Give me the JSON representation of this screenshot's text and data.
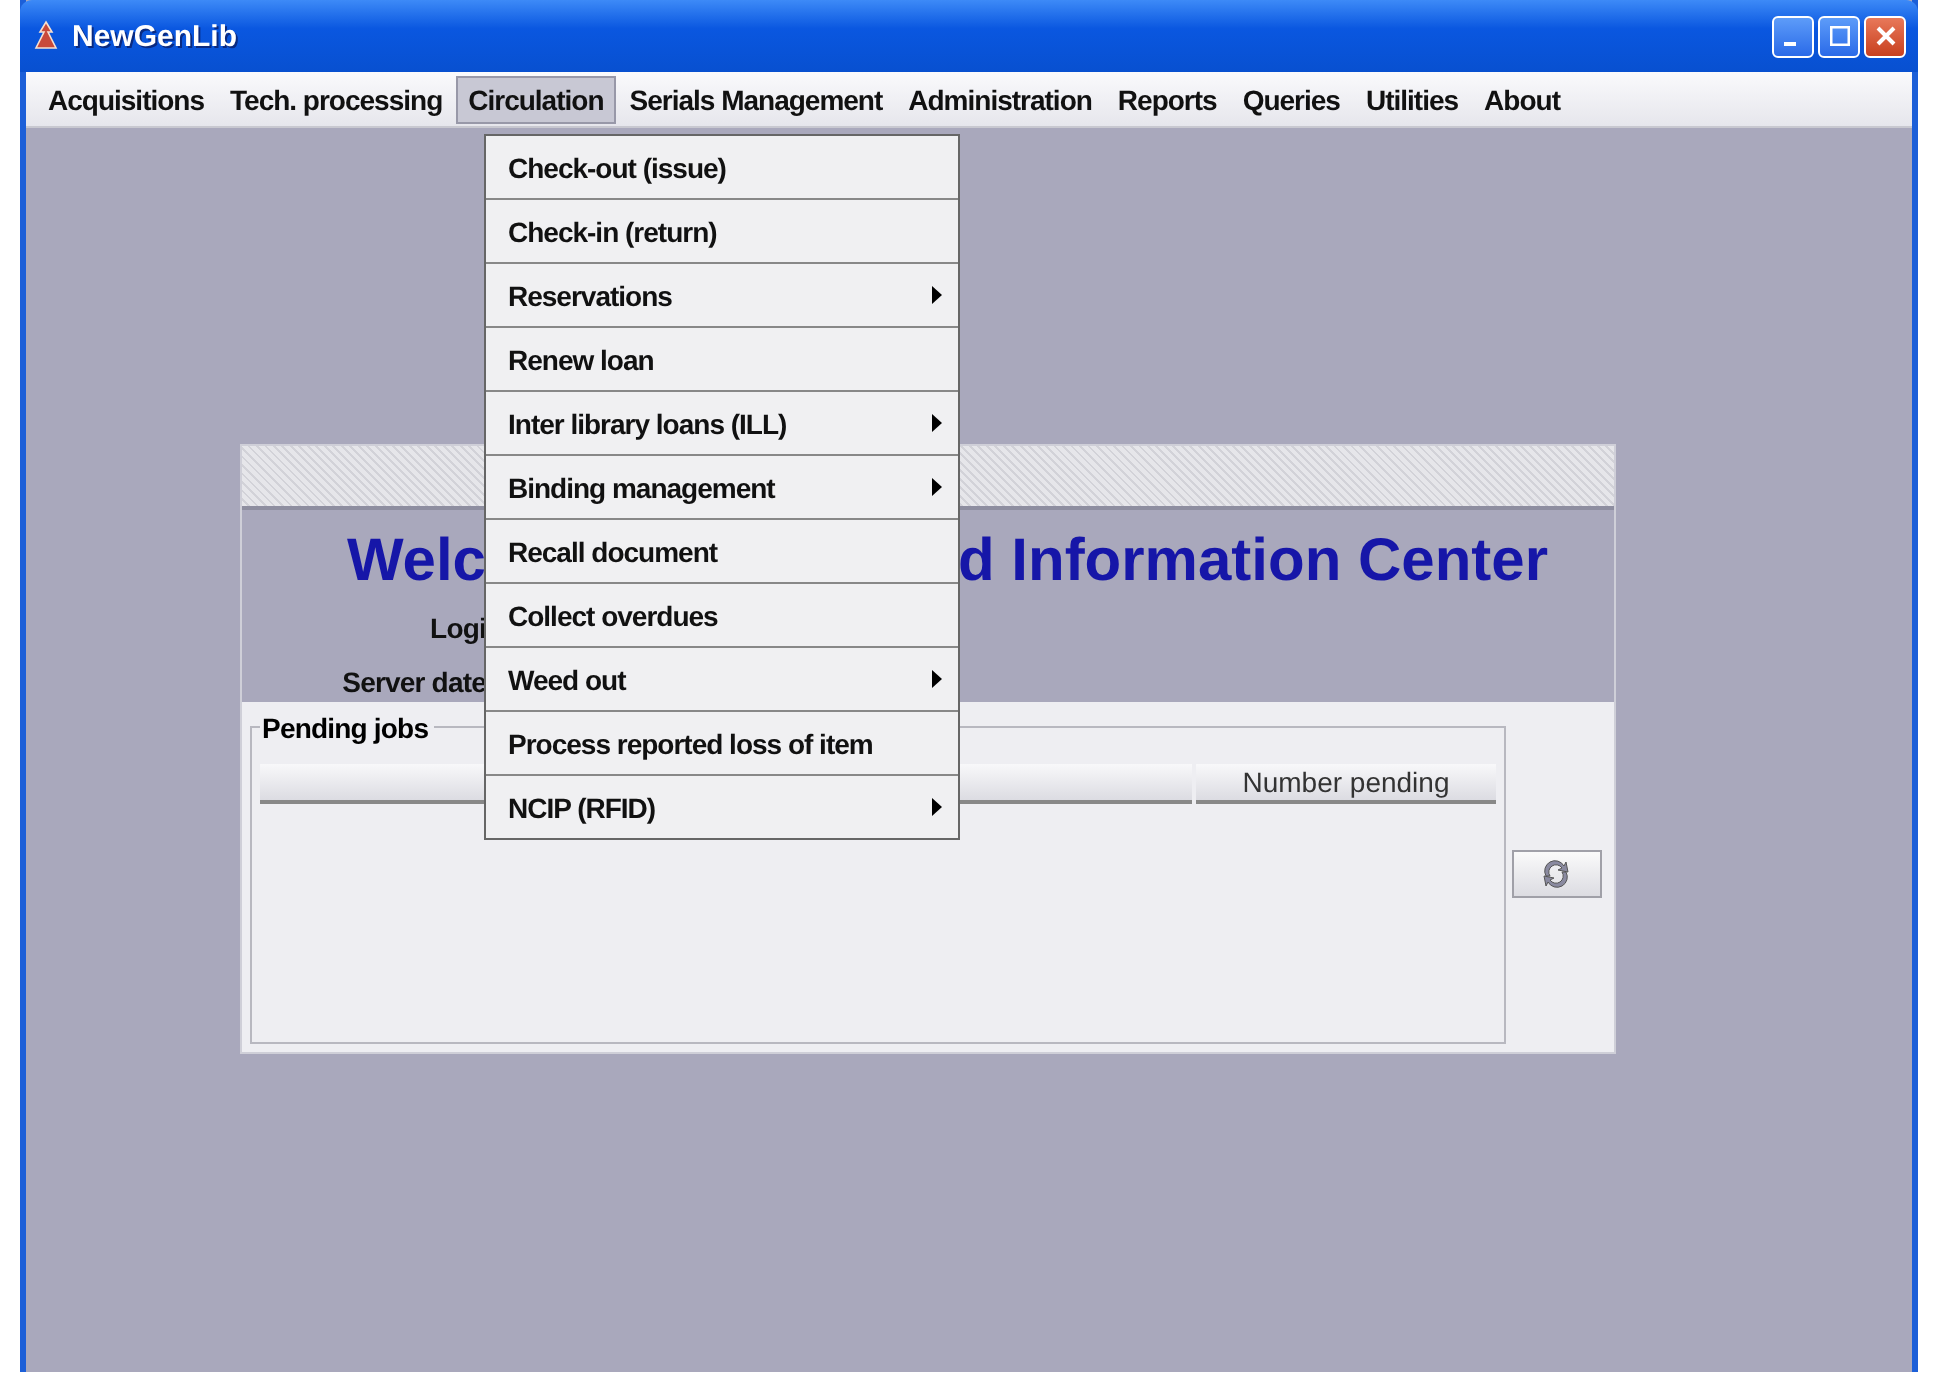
{
  "window": {
    "title": "NewGenLib"
  },
  "menu_bar": [
    {
      "label": "Acquisitions",
      "selected": false
    },
    {
      "label": "Tech. processing",
      "selected": false
    },
    {
      "label": "Circulation",
      "selected": true
    },
    {
      "label": "Serials Management",
      "selected": false
    },
    {
      "label": "Administration",
      "selected": false
    },
    {
      "label": "Reports",
      "selected": false
    },
    {
      "label": "Queries",
      "selected": false
    },
    {
      "label": "Utilities",
      "selected": false
    },
    {
      "label": "About",
      "selected": false
    }
  ],
  "circulation_menu": [
    {
      "label": "Check-out (issue)",
      "submenu": false
    },
    {
      "label": "Check-in (return)",
      "submenu": false
    },
    {
      "label": "Reservations",
      "submenu": true
    },
    {
      "label": "Renew loan",
      "submenu": false
    },
    {
      "label": "Inter library loans (ILL)",
      "submenu": true
    },
    {
      "label": "Binding management",
      "submenu": true
    },
    {
      "label": "Recall document",
      "submenu": false
    },
    {
      "label": "Collect overdues",
      "submenu": false
    },
    {
      "label": "Weed out",
      "submenu": true
    },
    {
      "label": "Process reported loss of item",
      "submenu": false
    },
    {
      "label": "NCIP (RFID)",
      "submenu": true
    }
  ],
  "welcome_frame": {
    "heading_left": "Welc",
    "heading_right": "d Information Center",
    "login_label": "Logi",
    "server_date_label": "Server date",
    "pending_jobs": {
      "title": "Pending jobs",
      "columns": [
        "Number pending"
      ]
    }
  }
}
